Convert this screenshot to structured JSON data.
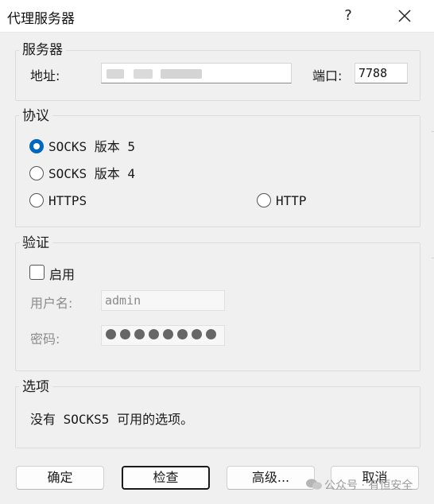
{
  "window": {
    "title": "代理服务器",
    "help_glyph": "?"
  },
  "server": {
    "legend": "服务器",
    "address_label": "地址:",
    "address_value": "",
    "port_label": "端口:",
    "port_value": "7788"
  },
  "protocol": {
    "legend": "协议",
    "options": [
      {
        "label": "SOCKS 版本 5",
        "checked": true
      },
      {
        "label": "SOCKS 版本 4",
        "checked": false
      },
      {
        "label": "HTTPS",
        "checked": false
      },
      {
        "label": "HTTP",
        "checked": false
      }
    ]
  },
  "auth": {
    "legend": "验证",
    "enable_label": "启用",
    "enabled": false,
    "username_label": "用户名:",
    "username_value": "admin",
    "password_label": "密码:",
    "password_mask_count": 8
  },
  "options": {
    "legend": "选项",
    "message": "没有 SOCKS5 可用的选项。"
  },
  "buttons": {
    "ok": "确定",
    "check": "检查",
    "advanced": "高级...",
    "cancel": "取消"
  },
  "watermark": {
    "text": "公众号 · 有恒安全"
  },
  "colors": {
    "accent": "#0067c0",
    "window_bg": "#f0f0f0",
    "titlebar_bg": "#ffffff"
  }
}
